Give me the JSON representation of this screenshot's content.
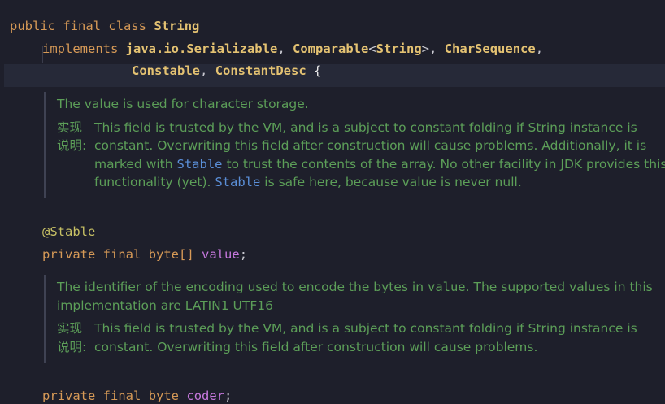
{
  "line1": {
    "kw1": "public",
    "kw2": "final",
    "kw3": "class",
    "name": "String"
  },
  "line2": {
    "kw": "implements",
    "t1": "java.io.Serializable",
    "comma1": ",",
    "t2": "Comparable",
    "lt": "<",
    "t2arg": "String",
    "gt": ">",
    "comma2": ",",
    "t3": "CharSequence",
    "comma3": ","
  },
  "line3": {
    "t4": "Constable",
    "comma4": ",",
    "t5": "ConstantDesc",
    "brace": "{"
  },
  "doc1": {
    "summary": "The value is used for character storage.",
    "impl_label": "实现\n说明:",
    "impl_a": "This field is trusted by the VM, and is a subject to constant folding if String instance is constant. Overwriting this field after construction will cause problems. Additionally, it is marked with ",
    "impl_ref1": "Stable",
    "impl_b": " to trust the contents of the array. No other facility in JDK provides this functionality (yet). ",
    "impl_ref2": "Stable",
    "impl_c": " is safe here, because value is never null."
  },
  "annot": "@Stable",
  "field1": {
    "kw1": "private",
    "kw2": "final",
    "type": "byte[]",
    "name": "value",
    "semi": ";"
  },
  "doc2": {
    "summary_a": "The identifier of the encoding used to encode the bytes in ",
    "summary_ref": "value",
    "summary_b": ". The supported values in this implementation are LATIN1 UTF16",
    "impl_label": "实现\n说明:",
    "impl": "This field is trusted by the VM, and is a subject to constant folding if String instance is constant. Overwriting this field after construction will cause problems."
  },
  "field2": {
    "kw1": "private",
    "kw2": "final",
    "type": "byte",
    "name": "coder",
    "semi": ";"
  }
}
